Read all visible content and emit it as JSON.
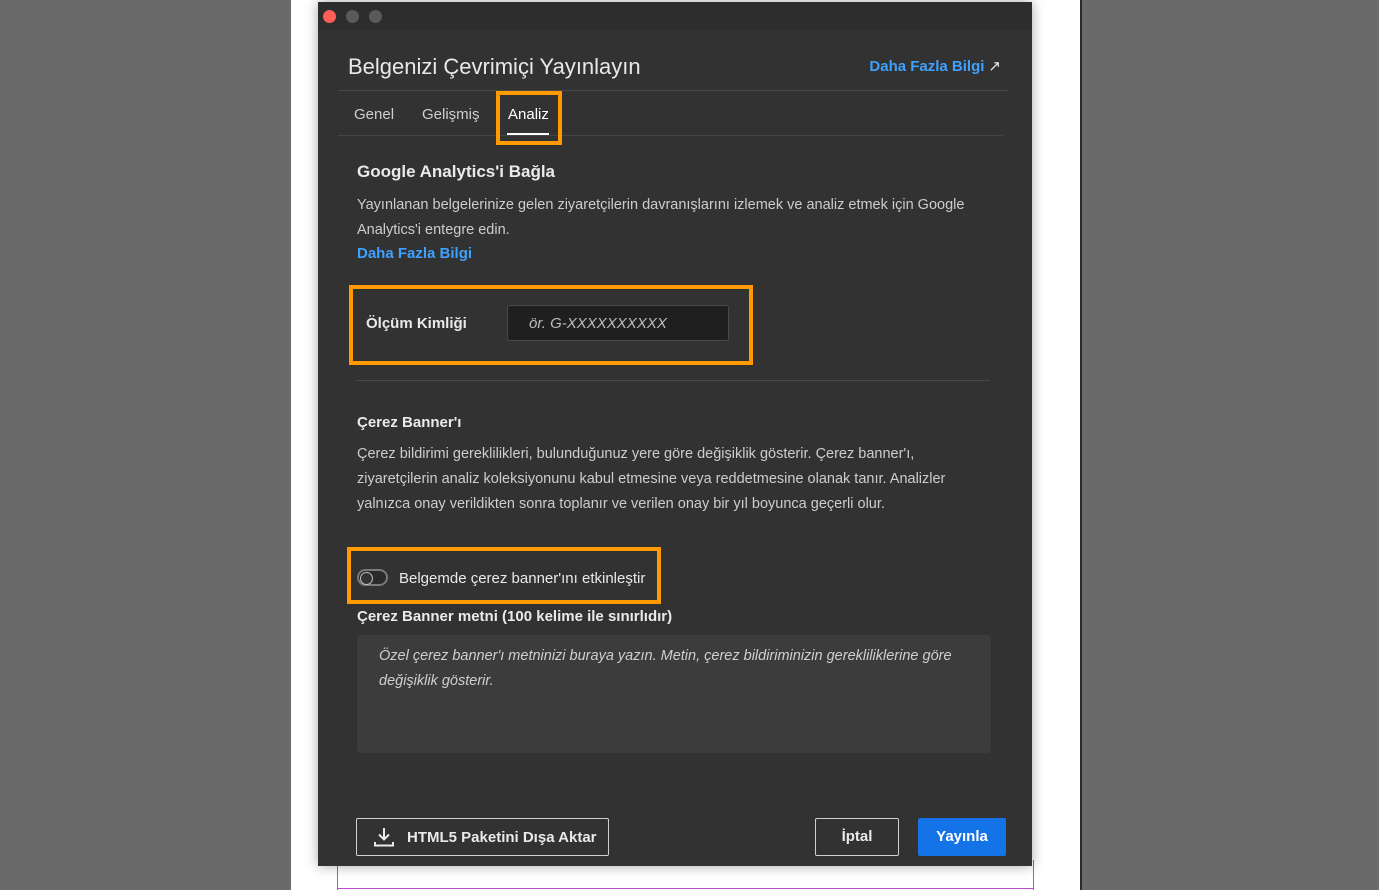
{
  "dialog": {
    "title": "Belgenizi Çevrimiçi Yayınlayın",
    "learn_more_top": "Daha Fazla Bilgi",
    "external_icon": "↗"
  },
  "tabs": [
    {
      "label": "Genel"
    },
    {
      "label": "Gelişmiş"
    },
    {
      "label": "Analiz",
      "active": true
    }
  ],
  "analytics": {
    "heading": "Google Analytics'i Bağla",
    "description": "Yayınlanan belgelerinize gelen ziyaretçilerin davranışlarını izlemek ve analiz etmek için Google Analytics'i entegre edin.",
    "learn_more": "Daha Fazla Bilgi",
    "measurement_label": "Ölçüm Kimliği",
    "measurement_placeholder": "ör. G-XXXXXXXXXX",
    "measurement_value": ""
  },
  "cookie": {
    "heading": "Çerez Banner'ı",
    "description": "Çerez bildirimi gereklilikleri, bulunduğunuz yere göre değişiklik gösterir. Çerez banner'ı, ziyaretçilerin analiz koleksiyonunu kabul etmesine veya reddetmesine olanak tanır. Analizler yalnızca onay verildikten sonra toplanır ve verilen onay bir yıl boyunca geçerli olur.",
    "toggle_label": "Belgemde çerez banner'ını etkinleştir",
    "toggle_on": false,
    "banner_text_label": "Çerez Banner metni (100 kelime ile sınırlıdır)",
    "banner_text_placeholder": "Özel çerez banner'ı metninizi buraya yazın. Metin, çerez bildiriminizin gerekliliklerine göre değişiklik gösterir."
  },
  "footer": {
    "export_label": "HTML5 Paketini Dışa Aktar",
    "cancel_label": "İptal",
    "publish_label": "Yayınla"
  },
  "colors": {
    "accent_blue": "#1473e6",
    "link_blue": "#3ea1ff",
    "highlight_orange": "#ff9a00",
    "dialog_bg": "#323232"
  }
}
